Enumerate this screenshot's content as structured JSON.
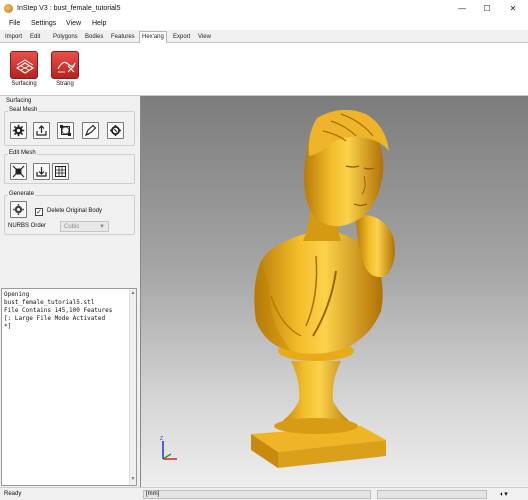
{
  "window": {
    "title": "InStep V3 : bust_female_tutorial5",
    "minimize_icon": "minimize-icon",
    "maximize_icon": "maximize-icon",
    "close_icon": "close-icon",
    "minimize_glyph": "—",
    "maximize_glyph": "☐",
    "close_glyph": "✕"
  },
  "menu": [
    "File",
    "Settings",
    "View",
    "Help"
  ],
  "tabs": [
    "Import",
    "Edit",
    "Polygons",
    "Bodies",
    "Features",
    "Hex'ang",
    "Export",
    "View"
  ],
  "active_tab": "Hex'ang",
  "ribbon": {
    "buttons": [
      {
        "label": "Surfacing",
        "icon": "surfacing-icon"
      },
      {
        "label": "Strang",
        "icon": "strang-icon"
      }
    ]
  },
  "panel": {
    "title": "Surfacing",
    "seal_mesh": {
      "label": "Seal Mesh",
      "tools": [
        "gear-icon",
        "export-icon",
        "frame-icon",
        "pen-icon",
        "settings-icon"
      ]
    },
    "edit_mesh": {
      "label": "Edit Mesh",
      "tools": [
        "shrink-icon",
        "download-icon",
        "grid-icon"
      ]
    },
    "generate": {
      "label": "Generate",
      "tool": "gear-icon",
      "delete_original_label": "Delete Original Body",
      "delete_original_checked": true,
      "checkmark": "✓",
      "nurbs_label": "NURBS Order",
      "nurbs_value": "Cubic"
    }
  },
  "console": {
    "lines": [
      "Opening",
      "bust_female_tutorial5.stl",
      "File Contains 145,100 Features",
      "[: Large File Mode Activated",
      "*]"
    ]
  },
  "status": {
    "ready": "Ready",
    "units": "[mm]",
    "view_icon": "view-mode-icon"
  },
  "colors": {
    "accent_red": "#d8342e",
    "model_gold": "#e8a812",
    "viewport_top": "#7c7c7c",
    "viewport_bottom": "#eeeeee"
  }
}
